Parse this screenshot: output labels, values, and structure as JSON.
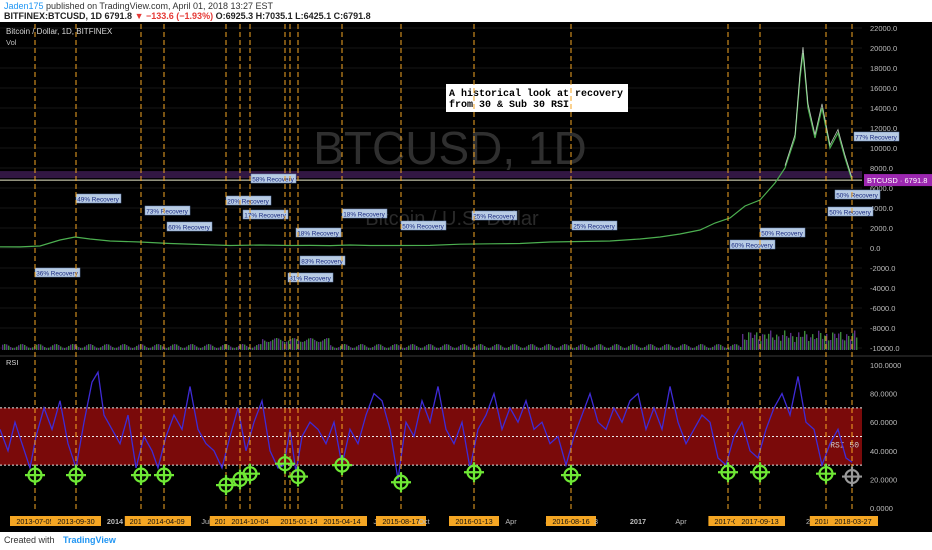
{
  "header": {
    "user": "Jaden175",
    "published": " published on TradingView.com, April 01, 2018 13:27 EST",
    "symbol": "BITFINEX:BTCUSD, 1D",
    "price": "6791.8",
    "change": "−133.6 (−1.93%)",
    "ohlc": "O:6925.3 H:7035.1 L:6425.1 C:6791.8"
  },
  "footer": {
    "created_with": "Created with",
    "brand": "TradingView"
  },
  "chart_data": [
    {
      "type": "line",
      "title": "Bitcoin / Dollar, 1D, BITFINEX",
      "sub_label": "Vol",
      "watermark": "BTCUSD, 1D",
      "watermark_sub": "Bitcoin / U.S. Dollar",
      "note_lines": [
        "A historical look at recovery",
        "from 30 & Sub 30 RSI"
      ],
      "ylim": [
        -10000,
        22000
      ],
      "y_ticks": [
        22000,
        20000,
        18000,
        16000,
        14000,
        12000,
        10000,
        8000,
        6000,
        4000,
        2000,
        0,
        -2000,
        -4000,
        -6000,
        -8000,
        -10000
      ],
      "y_tick_labels": [
        "22000.0",
        "20000.0",
        "18000.0",
        "16000.0",
        "14000.0",
        "12000.0",
        "10000.0",
        "8000.0",
        "6000.0",
        "4000.0",
        "2000.0",
        "0.0",
        "-2000.0",
        "-4000.0",
        "-6000.0",
        "-8000.0",
        "-10000.0"
      ],
      "last_price": 6791.8,
      "last_price_label": "BTCUSD · 6791.8",
      "price_series": [
        [
          0,
          120
        ],
        [
          20,
          110
        ],
        [
          40,
          200
        ],
        [
          60,
          800
        ],
        [
          75,
          1100
        ],
        [
          90,
          900
        ],
        [
          110,
          700
        ],
        [
          140,
          600
        ],
        [
          170,
          450
        ],
        [
          200,
          350
        ],
        [
          230,
          250
        ],
        [
          260,
          300
        ],
        [
          290,
          250
        ],
        [
          310,
          260
        ],
        [
          330,
          240
        ],
        [
          350,
          300
        ],
        [
          370,
          250
        ],
        [
          400,
          250
        ],
        [
          430,
          260
        ],
        [
          460,
          380
        ],
        [
          490,
          420
        ],
        [
          520,
          450
        ],
        [
          550,
          600
        ],
        [
          580,
          650
        ],
        [
          610,
          700
        ],
        [
          640,
          900
        ],
        [
          660,
          1100
        ],
        [
          680,
          1400
        ],
        [
          700,
          1800
        ],
        [
          715,
          2500
        ],
        [
          730,
          3000
        ],
        [
          745,
          4200
        ],
        [
          760,
          4800
        ],
        [
          775,
          6500
        ],
        [
          785,
          8000
        ],
        [
          795,
          11000
        ],
        [
          800,
          17000
        ],
        [
          803,
          19500
        ],
        [
          808,
          14000
        ],
        [
          815,
          11000
        ],
        [
          822,
          14000
        ],
        [
          830,
          10000
        ],
        [
          838,
          11500
        ],
        [
          845,
          9000
        ],
        [
          852,
          6791.8
        ]
      ],
      "annotations": [
        {
          "x": 57,
          "v": -2500,
          "text": "36% Recovery"
        },
        {
          "x": 98,
          "v": 4900,
          "text": "49% Recovery"
        },
        {
          "x": 167,
          "v": 3700,
          "text": "73% Recovery"
        },
        {
          "x": 189,
          "v": 2100,
          "text": "60% Recovery"
        },
        {
          "x": 248,
          "v": 4700,
          "text": "20% Recovery"
        },
        {
          "x": 273,
          "v": 6900,
          "text": "58% Recovery"
        },
        {
          "x": 265,
          "v": 3300,
          "text": "17% Recovery"
        },
        {
          "x": 318,
          "v": 1500,
          "text": "18% Recovery"
        },
        {
          "x": 322,
          "v": -1300,
          "text": "83% Recovery"
        },
        {
          "x": 310,
          "v": -3000,
          "text": "31% Recovery"
        },
        {
          "x": 364,
          "v": 3400,
          "text": "18% Recovery"
        },
        {
          "x": 423,
          "v": 2200,
          "text": "50% Recovery"
        },
        {
          "x": 494,
          "v": 3200,
          "text": "25% Recovery"
        },
        {
          "x": 594,
          "v": 2200,
          "text": "25% Recovery"
        },
        {
          "x": 752,
          "v": 300,
          "text": "60% Recovery"
        },
        {
          "x": 782,
          "v": 1500,
          "text": "50% Recovery"
        },
        {
          "x": 876,
          "v": 11100,
          "text": "77% Recovery"
        },
        {
          "x": 857,
          "v": 5300,
          "text": "50% Recovery"
        },
        {
          "x": 850,
          "v": 3600,
          "text": "50% Recovery"
        }
      ]
    },
    {
      "type": "line",
      "title": "RSI",
      "ylim": [
        0,
        100
      ],
      "y_ticks": [
        100,
        80,
        60,
        40,
        20,
        0
      ],
      "y_tick_labels": [
        "100.0000",
        "80.0000",
        "60.0000",
        "40.0000",
        "20.0000",
        "0.0000"
      ],
      "band": [
        30,
        70
      ],
      "midline": 50,
      "mid_label": "RSI 50",
      "series": [
        [
          0,
          55
        ],
        [
          8,
          40
        ],
        [
          15,
          60
        ],
        [
          22,
          45
        ],
        [
          30,
          28
        ],
        [
          36,
          50
        ],
        [
          44,
          70
        ],
        [
          52,
          55
        ],
        [
          60,
          75
        ],
        [
          68,
          45
        ],
        [
          76,
          28
        ],
        [
          84,
          60
        ],
        [
          92,
          88
        ],
        [
          98,
          95
        ],
        [
          104,
          65
        ],
        [
          112,
          55
        ],
        [
          120,
          45
        ],
        [
          128,
          65
        ],
        [
          136,
          28
        ],
        [
          144,
          50
        ],
        [
          152,
          40
        ],
        [
          158,
          28
        ],
        [
          166,
          50
        ],
        [
          174,
          65
        ],
        [
          182,
          55
        ],
        [
          190,
          85
        ],
        [
          198,
          55
        ],
        [
          206,
          45
        ],
        [
          214,
          40
        ],
        [
          222,
          28
        ],
        [
          230,
          50
        ],
        [
          238,
          70
        ],
        [
          246,
          40
        ],
        [
          254,
          60
        ],
        [
          262,
          75
        ],
        [
          270,
          40
        ],
        [
          278,
          28
        ],
        [
          284,
          30
        ],
        [
          290,
          55
        ],
        [
          296,
          25
        ],
        [
          302,
          50
        ],
        [
          310,
          60
        ],
        [
          318,
          55
        ],
        [
          326,
          45
        ],
        [
          334,
          60
        ],
        [
          342,
          30
        ],
        [
          350,
          55
        ],
        [
          358,
          45
        ],
        [
          366,
          65
        ],
        [
          374,
          80
        ],
        [
          382,
          75
        ],
        [
          390,
          55
        ],
        [
          398,
          20
        ],
        [
          406,
          60
        ],
        [
          414,
          50
        ],
        [
          422,
          75
        ],
        [
          430,
          60
        ],
        [
          438,
          85
        ],
        [
          446,
          55
        ],
        [
          454,
          45
        ],
        [
          462,
          60
        ],
        [
          470,
          28
        ],
        [
          478,
          55
        ],
        [
          486,
          65
        ],
        [
          494,
          80
        ],
        [
          502,
          55
        ],
        [
          510,
          70
        ],
        [
          518,
          60
        ],
        [
          526,
          75
        ],
        [
          534,
          55
        ],
        [
          542,
          60
        ],
        [
          550,
          45
        ],
        [
          558,
          50
        ],
        [
          566,
          30
        ],
        [
          574,
          50
        ],
        [
          582,
          65
        ],
        [
          590,
          80
        ],
        [
          598,
          60
        ],
        [
          606,
          55
        ],
        [
          614,
          70
        ],
        [
          622,
          60
        ],
        [
          630,
          75
        ],
        [
          638,
          80
        ],
        [
          646,
          55
        ],
        [
          654,
          70
        ],
        [
          662,
          55
        ],
        [
          670,
          85
        ],
        [
          678,
          60
        ],
        [
          686,
          45
        ],
        [
          694,
          55
        ],
        [
          702,
          65
        ],
        [
          710,
          60
        ],
        [
          718,
          35
        ],
        [
          726,
          30
        ],
        [
          734,
          50
        ],
        [
          742,
          60
        ],
        [
          750,
          40
        ],
        [
          758,
          35
        ],
        [
          766,
          55
        ],
        [
          774,
          70
        ],
        [
          782,
          80
        ],
        [
          790,
          65
        ],
        [
          798,
          92
        ],
        [
          806,
          60
        ],
        [
          814,
          55
        ],
        [
          822,
          30
        ],
        [
          830,
          45
        ],
        [
          838,
          55
        ],
        [
          846,
          35
        ],
        [
          852,
          32
        ]
      ],
      "markers": [
        {
          "x": 35,
          "v": 23,
          "gray": false
        },
        {
          "x": 76,
          "v": 23,
          "gray": false
        },
        {
          "x": 141,
          "v": 23,
          "gray": false
        },
        {
          "x": 164,
          "v": 23,
          "gray": false
        },
        {
          "x": 226,
          "v": 16,
          "gray": false
        },
        {
          "x": 240,
          "v": 20,
          "gray": false
        },
        {
          "x": 250,
          "v": 24,
          "gray": false
        },
        {
          "x": 285,
          "v": 31,
          "gray": false
        },
        {
          "x": 298,
          "v": 22,
          "gray": false
        },
        {
          "x": 342,
          "v": 30,
          "gray": false
        },
        {
          "x": 401,
          "v": 18,
          "gray": false
        },
        {
          "x": 474,
          "v": 25,
          "gray": false
        },
        {
          "x": 571,
          "v": 23,
          "gray": false
        },
        {
          "x": 728,
          "v": 25,
          "gray": false
        },
        {
          "x": 760,
          "v": 25,
          "gray": false
        },
        {
          "x": 826,
          "v": 24,
          "gray": false
        },
        {
          "x": 852,
          "v": 22,
          "gray": true
        }
      ]
    }
  ],
  "event_lines_x": [
    35,
    76,
    141,
    164,
    226,
    240,
    250,
    285,
    290,
    298,
    342,
    401,
    474,
    571,
    728,
    760,
    826,
    852
  ],
  "date_labels": [
    {
      "x": 35,
      "text": "2013-07-05",
      "highlight": true
    },
    {
      "x": 76,
      "text": "2013-09-30",
      "highlight": true
    },
    {
      "x": 115,
      "text": "2014",
      "highlight": false
    },
    {
      "x": 141,
      "text": "2014-0",
      "highlight": true
    },
    {
      "x": 166,
      "text": "2014-04-09",
      "highlight": true
    },
    {
      "x": 206,
      "text": "Jul",
      "highlight": false
    },
    {
      "x": 226,
      "text": "2014-2",
      "highlight": true
    },
    {
      "x": 250,
      "text": "2014-10-04",
      "highlight": true
    },
    {
      "x": 284,
      "text": "2",
      "highlight": true
    },
    {
      "x": 299,
      "text": "2015-01-14",
      "highlight": true
    },
    {
      "x": 342,
      "text": "2015-04-14",
      "highlight": true
    },
    {
      "x": 378,
      "text": "Jul",
      "highlight": false
    },
    {
      "x": 401,
      "text": "2015-08-17",
      "highlight": true
    },
    {
      "x": 424,
      "text": "Oct",
      "highlight": false
    },
    {
      "x": 474,
      "text": "2016-01-13",
      "highlight": true
    },
    {
      "x": 511,
      "text": "Apr",
      "highlight": false
    },
    {
      "x": 550,
      "text": "Jul",
      "highlight": false
    },
    {
      "x": 571,
      "text": "2016-08-16",
      "highlight": true
    },
    {
      "x": 596,
      "text": "3",
      "highlight": false
    },
    {
      "x": 638,
      "text": "2017",
      "highlight": false
    },
    {
      "x": 681,
      "text": "Apr",
      "highlight": false
    },
    {
      "x": 729,
      "text": "2017-07-",
      "highlight": true
    },
    {
      "x": 760,
      "text": "2017-09-13",
      "highlight": true
    },
    {
      "x": 808,
      "text": "2",
      "highlight": false
    },
    {
      "x": 826,
      "text": "2018-0",
      "highlight": true
    },
    {
      "x": 853,
      "text": "2018-03-27",
      "highlight": true
    }
  ],
  "colors": {
    "event": "#f5a623",
    "price": "#4caf50",
    "rsi": "#3f2bd6",
    "band": "#7a0a0a",
    "marker": "#6fe835",
    "label_bg": "#b8cce4",
    "label_fg": "#1a2a80",
    "last_price_bg": "#9c27b0"
  }
}
